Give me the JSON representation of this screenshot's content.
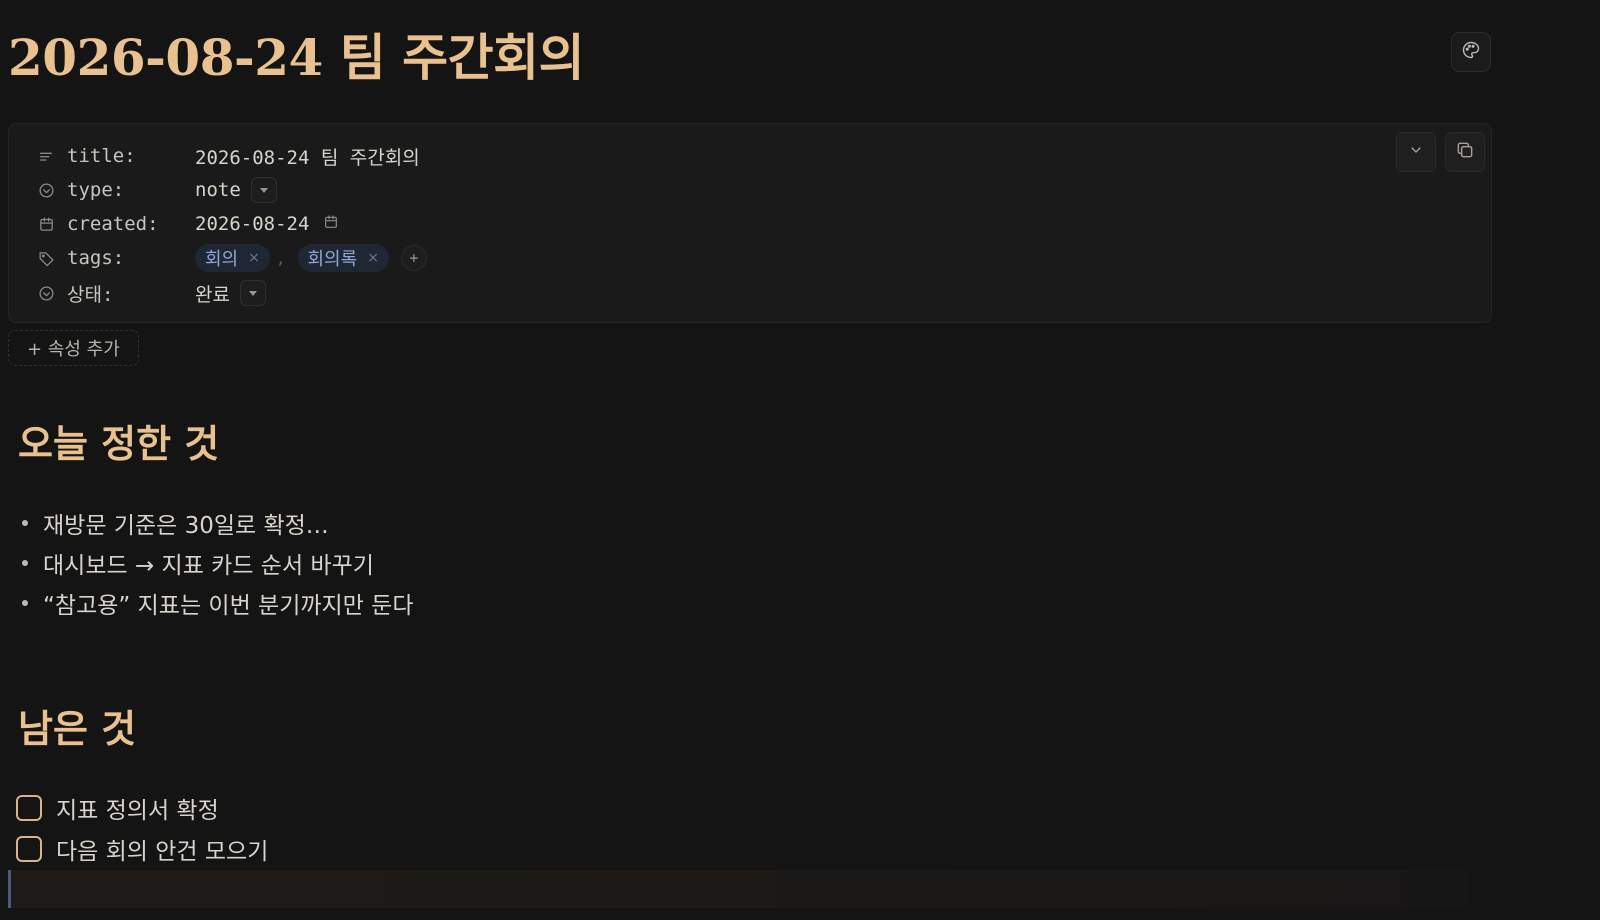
{
  "page": {
    "title": "2026-08-24 팀 주간회의"
  },
  "toolbar": {
    "theme_icon": "palette-icon",
    "collapse_icon": "chevron-down-icon",
    "copy_icon": "copy-icon"
  },
  "properties": {
    "title": {
      "key": "title:",
      "value": "2026-08-24 팀 주간회의",
      "icon": "text-lines-icon"
    },
    "type": {
      "key": "type:",
      "value": "note",
      "icon": "circle-check-icon"
    },
    "created": {
      "key": "created:",
      "value": "2026-08-24",
      "icon": "calendar-icon"
    },
    "tags": {
      "key": "tags:",
      "icon": "tag-icon",
      "items": [
        "회의",
        "회의록"
      ],
      "separator": ",",
      "remove_glyph": "×",
      "add_glyph": "+"
    },
    "status": {
      "key": "상태:",
      "value": "완료",
      "icon": "circle-check-icon"
    },
    "add_property_label": "+ 속성 추가"
  },
  "sections": {
    "decided": {
      "heading": "오늘 정한 것",
      "items": [
        "재방문 기준은 30일로 확정…",
        "대시보드 → 지표 카드 순서 바꾸기",
        "“참고용” 지표는 이번 분기까지만 둔다"
      ]
    },
    "remaining": {
      "heading": "남은 것",
      "tasks": [
        {
          "label": "지표 정의서 확정",
          "checked": false
        },
        {
          "label": "다음 회의 안건 모으기",
          "checked": false
        }
      ]
    }
  },
  "colors": {
    "background": "#141414",
    "heading": "#e9c08f",
    "tag_bg": "#1f2634",
    "tag_text": "#8fa8d6",
    "checkbox_border": "#d9b48a"
  }
}
